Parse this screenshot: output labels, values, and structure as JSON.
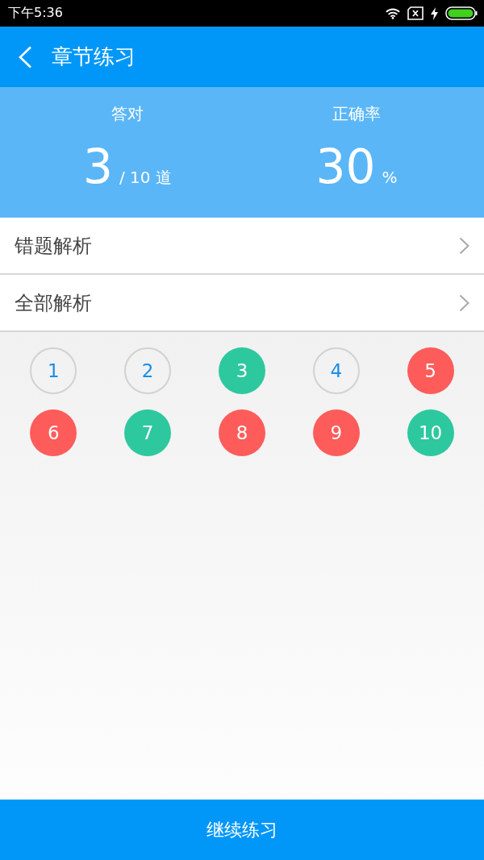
{
  "status_bar": {
    "time": "下午5:36"
  },
  "app_bar": {
    "title": "章节练习"
  },
  "stats": [
    {
      "label": "答对",
      "value": "3",
      "unit": "/ 10 道"
    },
    {
      "label": "正确率",
      "value": "30",
      "unit": "%"
    }
  ],
  "menu": [
    {
      "label": "错题解析"
    },
    {
      "label": "全部解析"
    }
  ],
  "questions": [
    {
      "number": "1",
      "kind": "unanswered"
    },
    {
      "number": "2",
      "kind": "unanswered"
    },
    {
      "number": "3",
      "kind": "correct"
    },
    {
      "number": "4",
      "kind": "unanswered"
    },
    {
      "number": "5",
      "kind": "wrong"
    },
    {
      "number": "6",
      "kind": "wrong"
    },
    {
      "number": "7",
      "kind": "correct"
    },
    {
      "number": "8",
      "kind": "wrong"
    },
    {
      "number": "9",
      "kind": "wrong"
    },
    {
      "number": "10",
      "kind": "correct"
    }
  ],
  "footer_button": {
    "label": "继续练习"
  }
}
